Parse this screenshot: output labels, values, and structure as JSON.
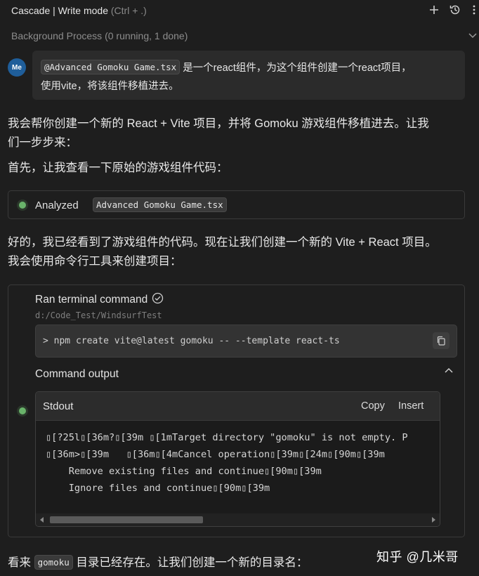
{
  "header": {
    "title": "Cascade | Write mode",
    "shortcut": "(Ctrl + .)",
    "icons": [
      "plus-icon",
      "history-icon",
      "more-icon"
    ]
  },
  "background": {
    "label": "Background Process (0 running, 1 done)"
  },
  "user": {
    "avatar": "Me",
    "file_chip": "@Advanced Gomoku Game.tsx",
    "line1": "是一个react组件，为这个组件创建一个react项目，",
    "line2": "使用vite，将该组件移植进去。"
  },
  "assistant": {
    "p1_line1": "我会帮你创建一个新的 React + Vite 项目，并将 Gomoku 游戏组件移植进去。让我",
    "p1_line2": "们一步步来：",
    "p2": "首先，让我查看一下原始的游戏组件代码：",
    "analyzed_label": "Analyzed",
    "analyzed_file": "Advanced Gomoku Game.tsx",
    "p3_line1": "好的，我已经看到了游戏组件的代码。现在让我们创建一个新的 Vite + React 项目。",
    "p3_line2": "我会使用命令行工具来创建项目："
  },
  "terminal": {
    "ran_label": "Ran terminal command",
    "cwd": "d:/Code_Test/WindsurfTest",
    "command": "> npm create vite@latest gomoku -- --template react-ts",
    "output_label": "Command output",
    "stdout_label": "Stdout",
    "copy_label": "Copy",
    "insert_label": "Insert",
    "lines": [
      "▯[?25l▯[36m?▯[39m ▯[1mTarget directory \"gomoku\" is not empty. P",
      "▯[36m>▯[39m   ▯[36m▯[4mCancel operation▯[39m▯[24m▯[90m▯[39m",
      "    Remove existing files and continue▯[90m▯[39m",
      "    Ignore files and continue▯[90m▯[39m"
    ]
  },
  "footer": {
    "prefix": "看来",
    "chip": "gomoku",
    "suffix": "目录已经存在。让我们创建一个新的目录名："
  },
  "watermark": "知乎 @几米哥"
}
